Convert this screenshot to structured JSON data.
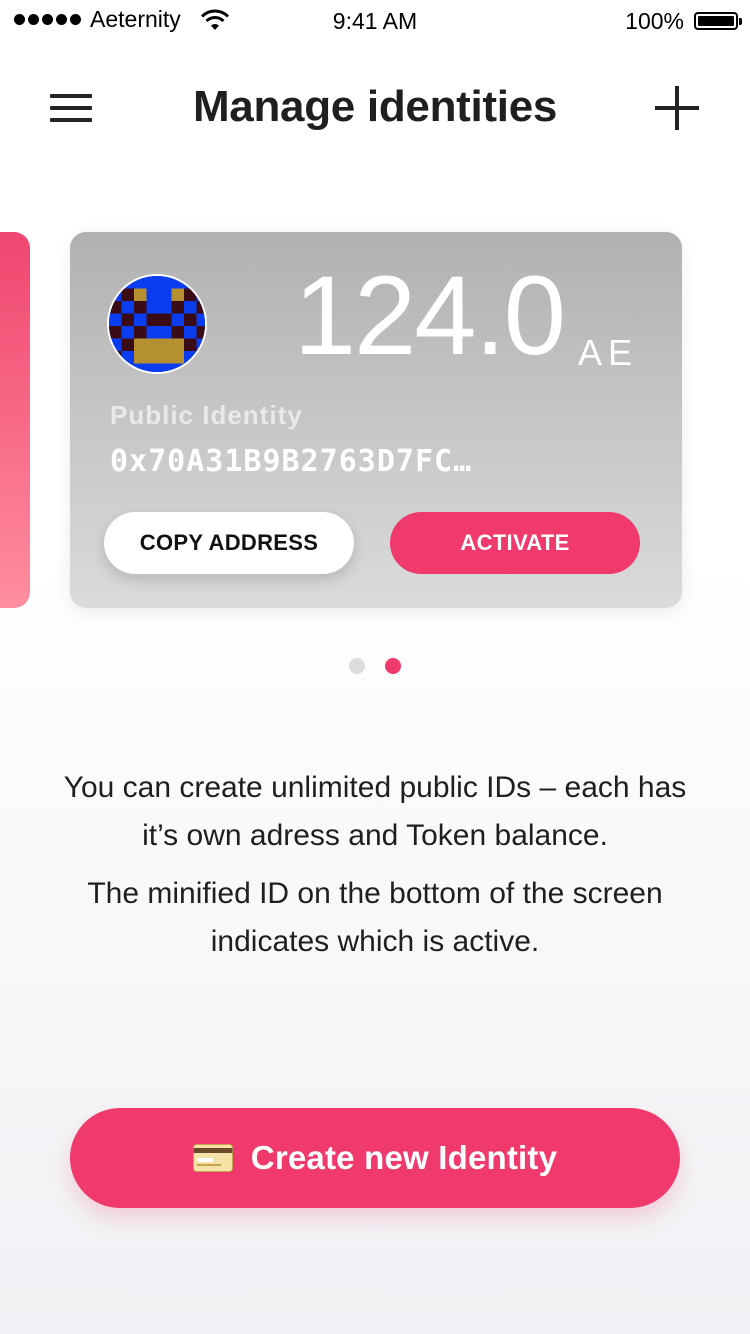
{
  "status_bar": {
    "carrier": "Aeternity",
    "time": "9:41 AM",
    "battery": "100%"
  },
  "header": {
    "title": "Manage identities",
    "menu_icon": "hamburger-menu-icon",
    "add_icon": "plus-icon"
  },
  "identity_card": {
    "balance": "124.0",
    "unit": "AE",
    "id_label": "Public Identity",
    "address": "0x70A31B9B2763D7FC…",
    "copy_label": "COPY ADDRESS",
    "activate_label": "ACTIVATE"
  },
  "pagination": {
    "total": 2,
    "active_index": 1
  },
  "info": {
    "paragraph1": "You can create unlimited public IDs – each has it’s own adress and Token balance.",
    "paragraph2": "The minified ID on the bottom of the screen indicates which is active."
  },
  "create_button": {
    "label": "Create new Identity",
    "icon": "credit-card-icon"
  },
  "colors": {
    "accent": "#f0396c",
    "card_top": "#b1b1b1",
    "card_bottom": "#dbdbdb"
  }
}
